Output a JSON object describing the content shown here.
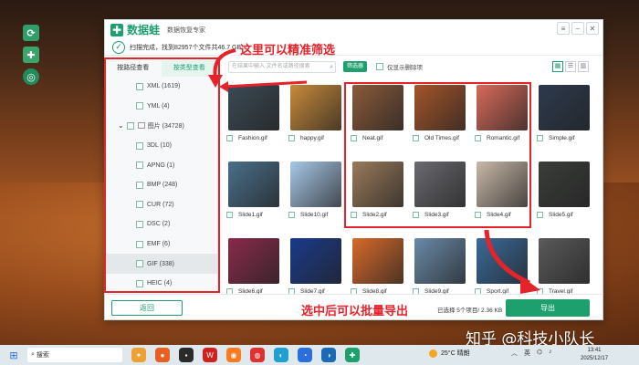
{
  "app": {
    "name": "数据蛙",
    "subtitle": "数据恢复专家",
    "scan_status": "扫描完成，找到82957个文件共46.7 GB。"
  },
  "sidebar": {
    "tabs": [
      "按路径查看",
      "按类型查看"
    ],
    "active_tab": 1,
    "items": [
      {
        "label": "XML (1619)",
        "level": 1
      },
      {
        "label": "YML (4)",
        "level": 1
      },
      {
        "label": "图片 (34728)",
        "level": 0
      },
      {
        "label": "3DL (10)",
        "level": 1
      },
      {
        "label": "APNG (1)",
        "level": 1
      },
      {
        "label": "BMP (248)",
        "level": 1
      },
      {
        "label": "CUR (72)",
        "level": 1
      },
      {
        "label": "DSC (2)",
        "level": 1
      },
      {
        "label": "EMF (6)",
        "level": 1
      },
      {
        "label": "GIF (338)",
        "level": 1,
        "selected": true
      },
      {
        "label": "HEIC (4)",
        "level": 1
      }
    ]
  },
  "toolbar": {
    "search_placeholder": "在结果中输入 文件名或路径搜索",
    "filter_label": "筛选器",
    "only_deleted_label": "仅显示删除项"
  },
  "files": [
    {
      "name": "Fashion.gif",
      "color": "#3b4a55"
    },
    {
      "name": "happy.gif",
      "color": "#c88a3a"
    },
    {
      "name": "Neat.gif",
      "color": "#8a5a3a"
    },
    {
      "name": "Old Times.gif",
      "color": "#a5552a"
    },
    {
      "name": "Romantic.gif",
      "color": "#d86a5a"
    },
    {
      "name": "Simple.gif",
      "color": "#2d3a4e"
    },
    {
      "name": "Slide1.gif",
      "color": "#4a6f8a"
    },
    {
      "name": "Slide10.gif",
      "color": "#a8c8e8"
    },
    {
      "name": "Slide2.gif",
      "color": "#9a7a5a"
    },
    {
      "name": "Slide3.gif",
      "color": "#6a6a70"
    },
    {
      "name": "Slide4.gif",
      "color": "#c8b8a8"
    },
    {
      "name": "Slide5.gif",
      "color": "#3a3d3a"
    },
    {
      "name": "Slide6.gif",
      "color": "#8a2a4a"
    },
    {
      "name": "Slide7.gif",
      "color": "#1a3a8a"
    },
    {
      "name": "Slide8.gif",
      "color": "#d86a2a"
    },
    {
      "name": "Slide9.gif",
      "color": "#6a8aa8"
    },
    {
      "name": "Sport.gif",
      "color": "#3a6a9a"
    },
    {
      "name": "Travel.gif",
      "color": "#5a5a5a"
    }
  ],
  "bottom": {
    "back_label": "返回",
    "selected_info": "已选择 5个项目/ 2.36 KB",
    "export_label": "导出"
  },
  "annotations": {
    "top_text": "这里可以精准筛选",
    "bottom_text": "选中后可以批量导出",
    "color": "#e5232a"
  },
  "watermark": "知乎 @科技小队长",
  "taskbar": {
    "search_label": "搜索",
    "weather": "25°C 晴朗",
    "ime": "英",
    "time": "13:41",
    "date": "2025/12/17"
  },
  "colors": {
    "accent": "#1e9f6e"
  }
}
